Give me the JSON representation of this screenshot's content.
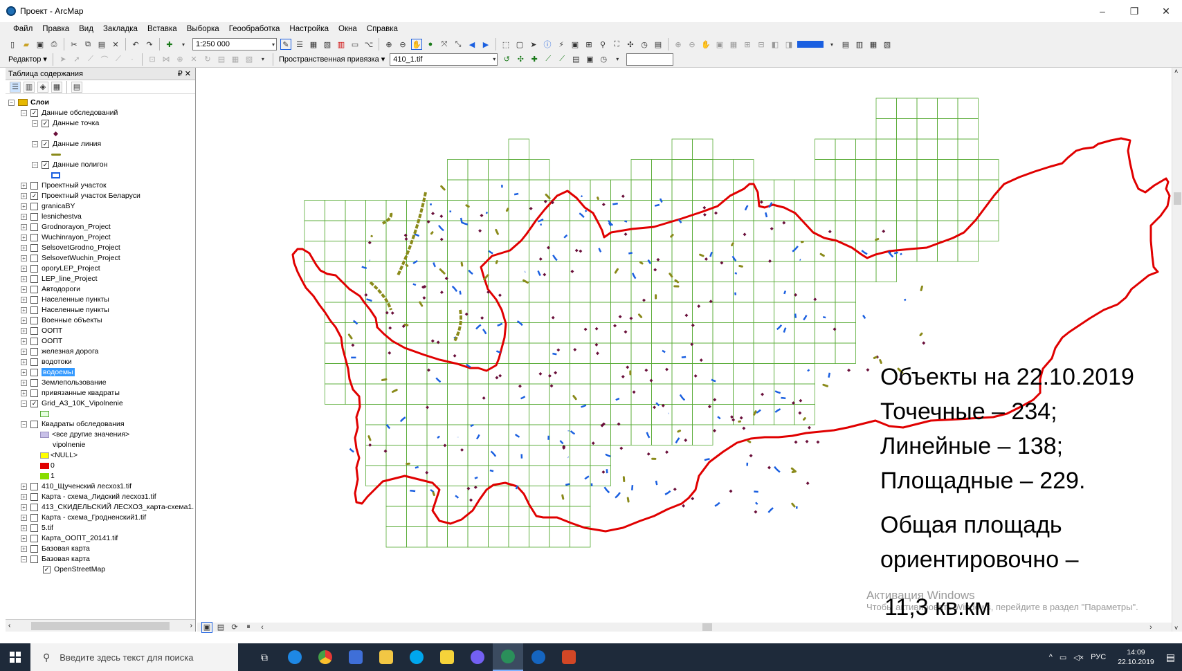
{
  "window": {
    "title": "Проект - ArcMap",
    "min": "–",
    "max": "❐",
    "close": "✕"
  },
  "menu": [
    "Файл",
    "Правка",
    "Вид",
    "Закладка",
    "Вставка",
    "Выборка",
    "Геообработка",
    "Настройка",
    "Окна",
    "Справка"
  ],
  "toolbar": {
    "scale": "1:250 000",
    "editor": "Редактор ▾",
    "georef": "Пространственная привязка ▾",
    "raster": "410_1.tif"
  },
  "toc": {
    "title": "Таблица содержания",
    "pin": "₽ ✕",
    "layers_root": "Слои",
    "items": [
      {
        "label": "Данные обследований",
        "checked": true,
        "expander": "⊟"
      },
      {
        "label": "Данные точка",
        "checked": true,
        "expander": "⊟"
      },
      {
        "label": "Данные линия",
        "checked": true,
        "expander": "⊟"
      },
      {
        "label": "Данные полигон",
        "checked": true,
        "expander": "⊟"
      },
      {
        "label": "Проектный участок",
        "checked": false
      },
      {
        "label": "Проектный участок Беларуси",
        "checked": true
      },
      {
        "label": "granicaBY",
        "checked": false
      },
      {
        "label": "lesnichestva",
        "checked": false
      },
      {
        "label": "Grodnorayon_Project",
        "checked": false
      },
      {
        "label": "Wuchinrayon_Project",
        "checked": false
      },
      {
        "label": "SelsovetGrodno_Project",
        "checked": false
      },
      {
        "label": "SelsovetWuchin_Project",
        "checked": false
      },
      {
        "label": "oporyLEP_Project",
        "checked": false
      },
      {
        "label": "LEP_line_Project",
        "checked": false
      },
      {
        "label": "Автодороги",
        "checked": false
      },
      {
        "label": "Населенные пункты",
        "checked": false
      },
      {
        "label": "Населенные пункты",
        "checked": false
      },
      {
        "label": "Военные объекты",
        "checked": false
      },
      {
        "label": "ООПТ",
        "checked": false
      },
      {
        "label": "ООПТ",
        "checked": false
      },
      {
        "label": "железная дорога",
        "checked": false
      },
      {
        "label": "водотоки",
        "checked": false
      },
      {
        "label": "водоемы",
        "checked": false,
        "selected": true
      },
      {
        "label": "Землепользование",
        "checked": false
      },
      {
        "label": "привязанные квадраты",
        "checked": false
      },
      {
        "label": "Grid_A3_10K_Vipolnenie",
        "checked": true
      },
      {
        "label": "Квадраты обследования",
        "checked": false,
        "expander": "⊟"
      },
      {
        "label": "410_Щученский лесхоз1.tif",
        "checked": false
      },
      {
        "label": "Карта - схема_Лидский лесхоз1.tif",
        "checked": false
      },
      {
        "label": "413_СКИДЕЛЬСКИЙ ЛЕСХОЗ_карта-схема1.",
        "checked": false
      },
      {
        "label": "Карта - схема_Гродненский1.tif",
        "checked": false
      },
      {
        "label": "5.tif",
        "checked": false
      },
      {
        "label": "Карта_ООПТ_20141.tif",
        "checked": false
      },
      {
        "label": "Базовая карта",
        "checked": false
      },
      {
        "label": "Базовая карта",
        "checked": false,
        "expander": "⊟"
      },
      {
        "label": "OpenStreetMap",
        "checked": true
      }
    ],
    "legend": {
      "other_values": "<все другие значения>",
      "field": "vipolnenie",
      "null": "<NULL>",
      "zero": "0",
      "one": "1"
    },
    "colors": {
      "point": "#6a0f3a",
      "line": "#8a8a1a",
      "polygon": "#1a5fe0",
      "null": "#ffff00",
      "zero": "#e00000",
      "one": "#88dd00",
      "other": "#c8c0e8",
      "grid": "#e6ffe0"
    }
  },
  "overlay": {
    "line1": "Объекты на 22.10.2019",
    "line2": "Точечные – 234;",
    "line3": "Линейные – 138;",
    "line4": "Площадные – 229.",
    "line5": "Общая площадь",
    "line6": "ориентировочно –",
    "line7": "11,3 кв.км"
  },
  "watermark": {
    "line1": "Активация Windows",
    "line2": "Чтобы активировать Windows, перейдите в раздел \"Параметры\"."
  },
  "taskbar": {
    "search_placeholder": "Введите здесь текст для поиска",
    "lang": "РУС",
    "time": "14:09",
    "date": "22.10.2019"
  }
}
